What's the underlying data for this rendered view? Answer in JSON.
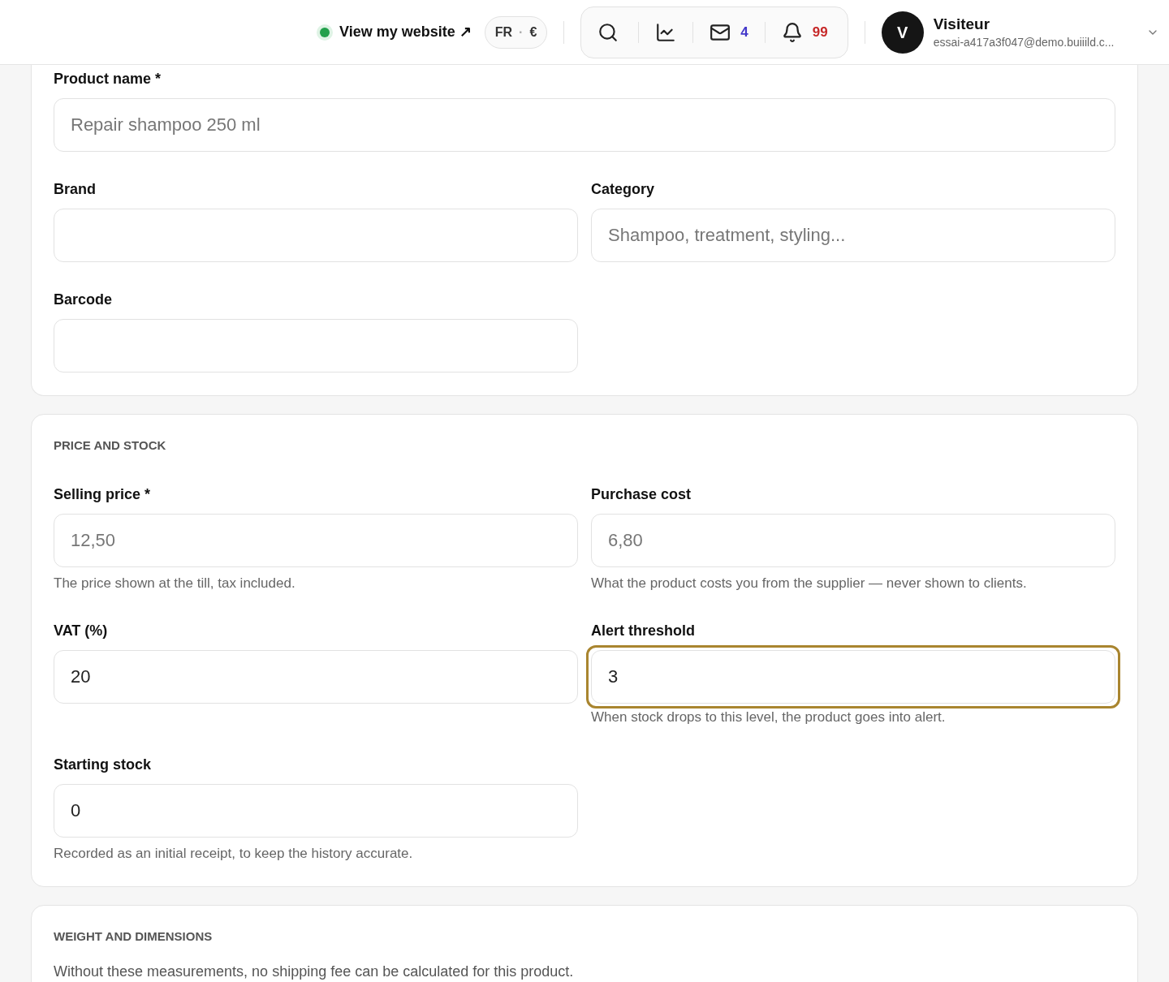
{
  "header": {
    "status": {
      "color": "#22a04b"
    },
    "site_link": "View my website ↗",
    "locale": {
      "language": "FR",
      "separator": "·",
      "currency": "€"
    },
    "messages_count": "4",
    "notifications_count": "99",
    "user": {
      "initial": "V",
      "name": "Visiteur",
      "email": "essai-a417a3f047@demo.buiiild.c..."
    }
  },
  "sections": [
    {
      "fields": [
        {
          "label": "Product name *",
          "kind": "wide",
          "placeholder": "Repair shampoo 250 ml",
          "focused": false
        },
        {
          "label": "Brand",
          "kind": "half",
          "focused": false
        },
        {
          "label": "Category",
          "kind": "half",
          "placeholder": "Shampoo, treatment, styling...",
          "focused": false
        },
        {
          "label": "Barcode",
          "kind": "half",
          "focused": false
        }
      ]
    },
    {
      "title": "PRICE AND STOCK",
      "fields": [
        {
          "label": "Selling price *",
          "kind": "half",
          "placeholder": "12,50",
          "help": "The price shown at the till, tax included.",
          "focused": false
        },
        {
          "label": "Purchase cost",
          "kind": "half",
          "placeholder": "6,80",
          "help": "What the product costs you from the supplier — never shown to clients.",
          "focused": false
        },
        {
          "label": "VAT (%)",
          "kind": "half",
          "value": "20",
          "focused": false
        },
        {
          "label": "Alert threshold",
          "kind": "half",
          "value": "3",
          "help": "When stock drops to this level, the product goes into alert.",
          "focused": true
        },
        {
          "label": "Starting stock",
          "kind": "half",
          "value": "0",
          "help": "Recorded as an initial receipt, to keep the history accurate.",
          "focused": false
        }
      ]
    },
    {
      "title": "WEIGHT AND DIMENSIONS",
      "description": "Without these measurements, no shipping fee can be calculated for this product."
    }
  ]
}
